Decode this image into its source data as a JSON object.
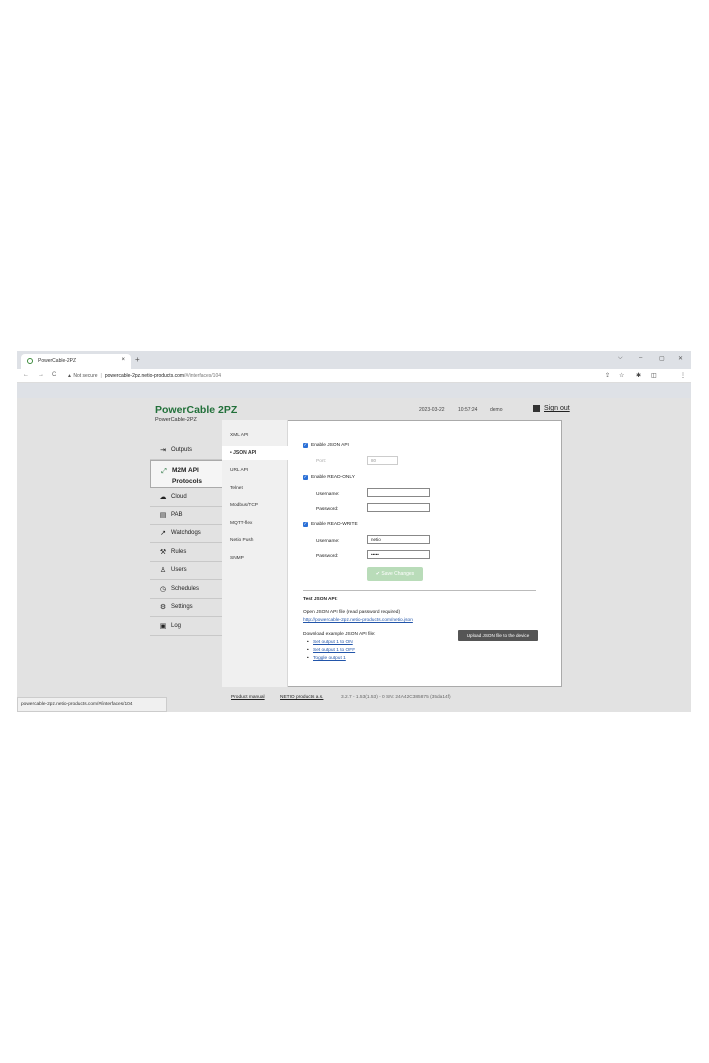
{
  "browser": {
    "tab_title": "PowerCable-2PZ",
    "tab_close": "×",
    "new_tab": "+",
    "nav": {
      "back": "←",
      "forward": "→",
      "reload": "C"
    },
    "security": "▲ Not secure",
    "host": "powercable-2pz.netio-products.com",
    "path": "/#/interfaces/104",
    "window": {
      "minimize": "–",
      "restore": "▢",
      "close": "✕",
      "tabs": "⌵"
    },
    "icons": {
      "share": "⇪",
      "star": "☆",
      "ext": "✱",
      "side": "◫",
      "menu": "⋮"
    }
  },
  "header": {
    "brand": "PowerCable 2PZ",
    "device": "PowerCable-2PZ",
    "date": "2023-03-22",
    "time": "10:57:24",
    "user": "demo",
    "sign_out": "Sign out"
  },
  "menu": [
    {
      "icon": "⇥",
      "label": "Outputs"
    },
    {
      "icon": "⤢",
      "label": "M2M API Protocols"
    },
    {
      "icon": "☁",
      "label": "Cloud"
    },
    {
      "icon": "▤",
      "label": "PAB"
    },
    {
      "icon": "↗",
      "label": "Watchdogs"
    },
    {
      "icon": "⚒",
      "label": "Rules"
    },
    {
      "icon": "♙",
      "label": "Users"
    },
    {
      "icon": "◷",
      "label": "Schedules"
    },
    {
      "icon": "⚙",
      "label": "Settings"
    },
    {
      "icon": "▣",
      "label": "Log"
    }
  ],
  "submenu": [
    "XML API",
    "• JSON API",
    "URL API",
    "Telnet",
    "Modbus/TCP",
    "MQTT-flex",
    "Netio Push",
    "SNMP"
  ],
  "form": {
    "enable_json": "Enable JSON API",
    "port_label": "Port:",
    "port_value": "80",
    "enable_ro": "Enable READ-ONLY",
    "ro_user_label": "Username:",
    "ro_user_value": "",
    "ro_pass_label": "Password:",
    "ro_pass_value": "",
    "enable_rw": "Enable READ-WRITE",
    "rw_user_label": "Username:",
    "rw_user_value": "netio",
    "rw_pass_label": "Password:",
    "rw_pass_value": "•••••",
    "save": "✔ Save Changes"
  },
  "test": {
    "title": "Test JSON API:",
    "open_text": "Open JSON API file (read password required)",
    "open_link": "http://powercable-2pz.netio-products.com/netio.json",
    "download_text": "Download example JSON API file:",
    "links": [
      "Set output 1 to ON",
      "Set output 1 to OFF",
      "Toggle output 1"
    ],
    "upload": "Upload JSON file to the device"
  },
  "footer": {
    "manual": "Product manual",
    "company": "NETIO products a.s.",
    "version": "3.2.7 - 1.53(1.53) - 0 SN: 24A42C385875 (35da14f)"
  },
  "status_url": "powercable-2pz.netio-products.com/#/interfaces/104"
}
